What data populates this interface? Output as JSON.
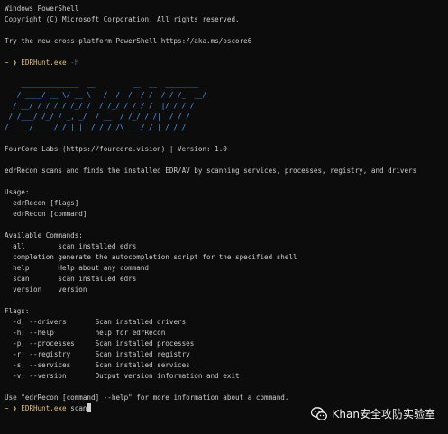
{
  "header": {
    "title_line": "Windows PowerShell",
    "copyright": "Copyright (C) Microsoft Corporation. All rights reserved.",
    "try_line": "Try the new cross-platform PowerShell https://aka.ms/pscore6"
  },
  "prompt1": {
    "arrow": "~ ❯",
    "command": "EDRHunt.exe",
    "flag": "-h"
  },
  "banner": {
    "lines": [
      "    ______________  __         __  __  ________",
      "   / ____/ __ \\/ __ \\   /  /  /  / /  / / /_  __/",
      "  / __/ / / / / /_/ /  / /_/ / / / /  |/ / / /",
      " / /___/ /_/ / _, _/  / __  / /_/ / /|  / / /",
      "/_____/_____/_/ |_|  /_/ /_/\\____/_/ |_/ /_/"
    ]
  },
  "info": {
    "version_line": "FourCore Labs (https://fourcore.vision) | Version: 1.0",
    "description": "edrRecon scans and finds the installed EDR/AV by scanning services, processes, registry, and drivers"
  },
  "usage": {
    "title": "Usage:",
    "lines": [
      "  edrRecon [flags]",
      "  edrRecon [command]"
    ]
  },
  "commands": {
    "title": "Available Commands:",
    "items": [
      {
        "name": "  all",
        "desc": "scan installed edrs"
      },
      {
        "name": "  completion",
        "desc": "generate the autocompletion script for the specified shell"
      },
      {
        "name": "  help",
        "desc": "Help about any command"
      },
      {
        "name": "  scan",
        "desc": "scan installed edrs"
      },
      {
        "name": "  version",
        "desc": "version"
      }
    ]
  },
  "flags": {
    "title": "Flags:",
    "items": [
      {
        "name": "  -d, --drivers",
        "desc": "Scan installed drivers"
      },
      {
        "name": "  -h, --help",
        "desc": "help for edrRecon"
      },
      {
        "name": "  -p, --processes",
        "desc": "Scan installed processes"
      },
      {
        "name": "  -r, --registry",
        "desc": "Scan installed registry"
      },
      {
        "name": "  -s, --services",
        "desc": "Scan installed services"
      },
      {
        "name": "  -v, --version",
        "desc": "Output version information and exit"
      }
    ]
  },
  "footer": {
    "help_hint": "Use \"edrRecon [command] --help\" for more information about a command."
  },
  "prompt2": {
    "arrow": "~ ❯",
    "command": "EDRHunt.exe",
    "input": "scan"
  },
  "watermark": {
    "text": "Khan安全攻防实验室",
    "icon": "wechat-icon"
  },
  "colors": {
    "background": "#0c0c0c",
    "text": "#cccccc",
    "prompt_accent": "#e5c07b",
    "banner": "#4ea1ff"
  }
}
